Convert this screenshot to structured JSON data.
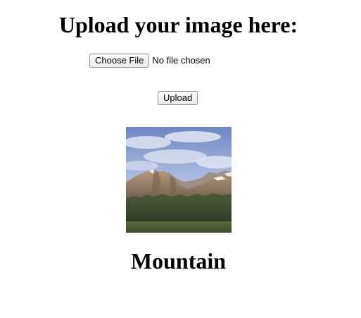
{
  "page": {
    "heading": "Upload your image here:"
  },
  "file_input": {
    "button_label": "Choose File",
    "status_text": "No file chosen"
  },
  "upload": {
    "button_label": "Upload"
  },
  "result": {
    "image_alt": "Mountain",
    "caption": "Mountain"
  }
}
